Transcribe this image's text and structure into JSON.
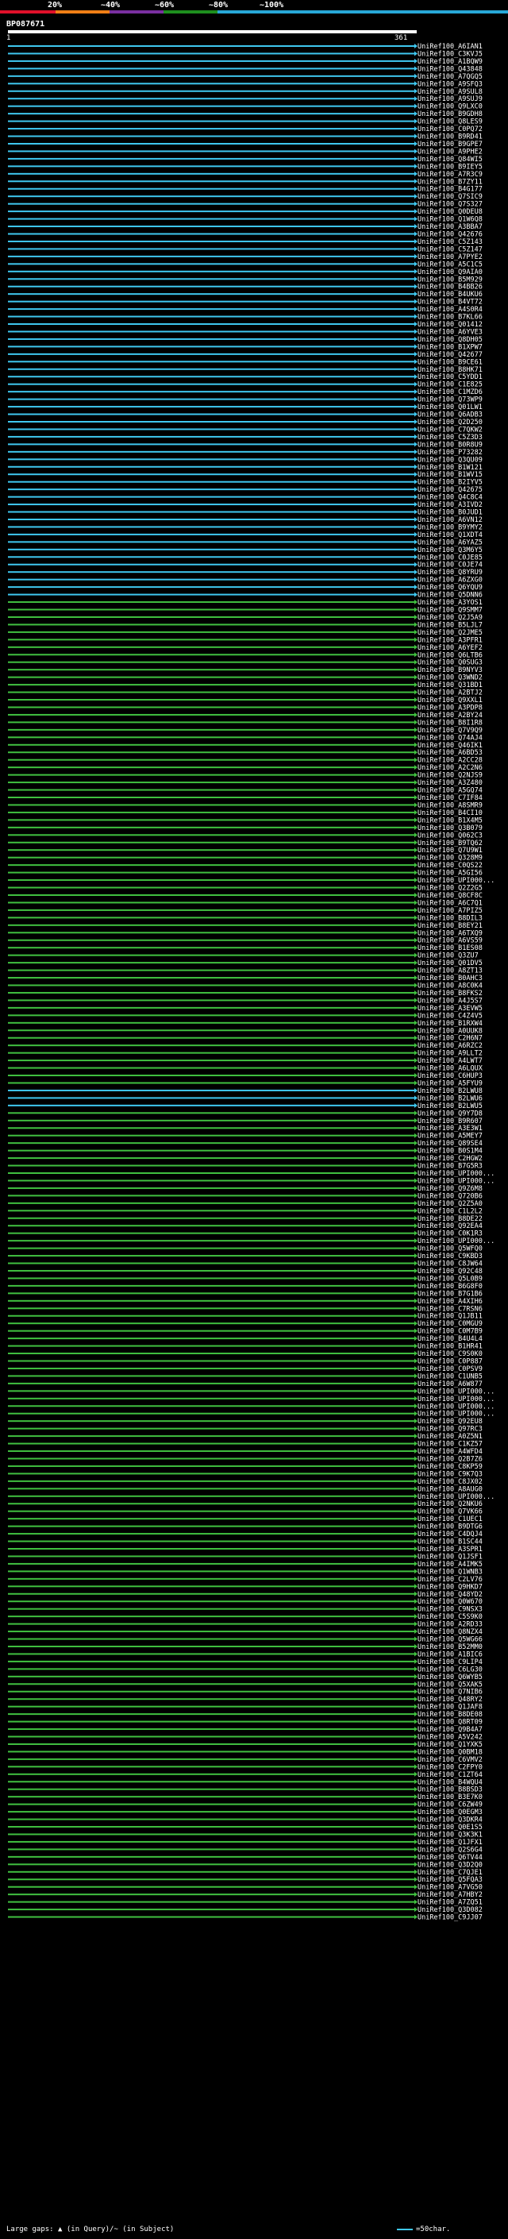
{
  "scale": {
    "ticks": [
      "20%",
      "~40%",
      "~60%",
      "~80%",
      "~100%"
    ],
    "colors": [
      "#e0102a",
      "#f07f16",
      "#7a2fa0",
      "#1e8f1e",
      "#28a8d8"
    ]
  },
  "query": {
    "id": "BP087671",
    "start": "1",
    "end": "361"
  },
  "colors": {
    "blue": "#3fc8f0",
    "green": "#40c040",
    "background": "#000000"
  },
  "hits": [
    {
      "id": "UniRef100_A6IAN1",
      "c": "b"
    },
    {
      "id": "UniRef100_C3KVJ5",
      "c": "b"
    },
    {
      "id": "UniRef100_A1BQW9",
      "c": "b"
    },
    {
      "id": "UniRef100_Q43848",
      "c": "b"
    },
    {
      "id": "UniRef100_A7QGQ5",
      "c": "b"
    },
    {
      "id": "UniRef100_A9SFQ3",
      "c": "b"
    },
    {
      "id": "UniRef100_A9SUL8",
      "c": "b"
    },
    {
      "id": "UniRef100_A9SUJ9",
      "c": "b"
    },
    {
      "id": "UniRef100_Q9LXC0",
      "c": "b"
    },
    {
      "id": "UniRef100_B9GDH8",
      "c": "b"
    },
    {
      "id": "UniRef100_Q8LES9",
      "c": "b"
    },
    {
      "id": "UniRef100_C0PQ72",
      "c": "b"
    },
    {
      "id": "UniRef100_B9RD41",
      "c": "b"
    },
    {
      "id": "UniRef100_B9GPE7",
      "c": "b"
    },
    {
      "id": "UniRef100_A9PHE2",
      "c": "b"
    },
    {
      "id": "UniRef100_Q84WI5",
      "c": "b"
    },
    {
      "id": "UniRef100_B9IEY5",
      "c": "b"
    },
    {
      "id": "UniRef100_A7R3C9",
      "c": "b"
    },
    {
      "id": "UniRef100_B7ZY11",
      "c": "b"
    },
    {
      "id": "UniRef100_B4G177",
      "c": "b"
    },
    {
      "id": "UniRef100_Q7SIC9",
      "c": "b"
    },
    {
      "id": "UniRef100_Q7S327",
      "c": "b"
    },
    {
      "id": "UniRef100_Q0DEU8",
      "c": "b"
    },
    {
      "id": "UniRef100_Q1W6Q8",
      "c": "b"
    },
    {
      "id": "UniRef100_A3BBA7",
      "c": "b"
    },
    {
      "id": "UniRef100_Q42676",
      "c": "b"
    },
    {
      "id": "UniRef100_C5Z143",
      "c": "b"
    },
    {
      "id": "UniRef100_C5Z147",
      "c": "b"
    },
    {
      "id": "UniRef100_A7PYE2",
      "c": "b"
    },
    {
      "id": "UniRef100_A5C1C5",
      "c": "b"
    },
    {
      "id": "UniRef100_Q9AIA0",
      "c": "b"
    },
    {
      "id": "UniRef100_B5M929",
      "c": "b"
    },
    {
      "id": "UniRef100_B4BB26",
      "c": "b"
    },
    {
      "id": "UniRef100_B4UKU6",
      "c": "b"
    },
    {
      "id": "UniRef100_B4VT72",
      "c": "b"
    },
    {
      "id": "UniRef100_A4S0R4",
      "c": "b"
    },
    {
      "id": "UniRef100_B7KL66",
      "c": "b"
    },
    {
      "id": "UniRef100_Q01412",
      "c": "b"
    },
    {
      "id": "UniRef100_A6YVE3",
      "c": "b"
    },
    {
      "id": "UniRef100_Q8DH05",
      "c": "b"
    },
    {
      "id": "UniRef100_B1XPW7",
      "c": "b"
    },
    {
      "id": "UniRef100_Q42677",
      "c": "b"
    },
    {
      "id": "UniRef100_B9CE61",
      "c": "b"
    },
    {
      "id": "UniRef100_B8HK71",
      "c": "b"
    },
    {
      "id": "UniRef100_C5YDD1",
      "c": "b"
    },
    {
      "id": "UniRef100_C1E825",
      "c": "b"
    },
    {
      "id": "UniRef100_C1MZD6",
      "c": "b"
    },
    {
      "id": "UniRef100_Q73WP9",
      "c": "b"
    },
    {
      "id": "UniRef100_Q01LW1",
      "c": "b"
    },
    {
      "id": "UniRef100_Q6ADB3",
      "c": "b"
    },
    {
      "id": "UniRef100_Q2D250",
      "c": "b"
    },
    {
      "id": "UniRef100_C7QKW2",
      "c": "b"
    },
    {
      "id": "UniRef100_C5Z3D3",
      "c": "b"
    },
    {
      "id": "UniRef100_B0R8U9",
      "c": "b"
    },
    {
      "id": "UniRef100_P73282",
      "c": "b"
    },
    {
      "id": "UniRef100_Q3QU09",
      "c": "b"
    },
    {
      "id": "UniRef100_B1W121",
      "c": "b"
    },
    {
      "id": "UniRef100_B1WV15",
      "c": "b"
    },
    {
      "id": "UniRef100_B2IYV5",
      "c": "b"
    },
    {
      "id": "UniRef100_Q42675",
      "c": "b"
    },
    {
      "id": "UniRef100_Q4C8C4",
      "c": "b"
    },
    {
      "id": "UniRef100_A3IVD2",
      "c": "b"
    },
    {
      "id": "UniRef100_B0JUD1",
      "c": "b"
    },
    {
      "id": "UniRef100_A6VN12",
      "c": "b"
    },
    {
      "id": "UniRef100_B9YMY2",
      "c": "b"
    },
    {
      "id": "UniRef100_Q1XDT4",
      "c": "b"
    },
    {
      "id": "UniRef100_A6YAZ5",
      "c": "b"
    },
    {
      "id": "UniRef100_Q3M6Y5",
      "c": "b"
    },
    {
      "id": "UniRef100_C0JE85",
      "c": "b"
    },
    {
      "id": "UniRef100_C0JE74",
      "c": "b"
    },
    {
      "id": "UniRef100_Q8YRU9",
      "c": "b"
    },
    {
      "id": "UniRef100_A6ZXG0",
      "c": "b"
    },
    {
      "id": "UniRef100_Q6YQU9",
      "c": "b"
    },
    {
      "id": "UniRef100_Q5DNN6",
      "c": "b"
    },
    {
      "id": "UniRef100_A3YOS1",
      "c": "g"
    },
    {
      "id": "UniRef100_Q9SMM7",
      "c": "g"
    },
    {
      "id": "UniRef100_Q2J5A9",
      "c": "g"
    },
    {
      "id": "UniRef100_B5LJL7",
      "c": "g"
    },
    {
      "id": "UniRef100_Q2JME5",
      "c": "g"
    },
    {
      "id": "UniRef100_A3PFR1",
      "c": "g"
    },
    {
      "id": "UniRef100_A6YEF2",
      "c": "g"
    },
    {
      "id": "UniRef100_Q6LTB6",
      "c": "g"
    },
    {
      "id": "UniRef100_Q0SUG3",
      "c": "g"
    },
    {
      "id": "UniRef100_B9NYV3",
      "c": "g"
    },
    {
      "id": "UniRef100_Q3WND2",
      "c": "g"
    },
    {
      "id": "UniRef100_Q31BD1",
      "c": "g"
    },
    {
      "id": "UniRef100_A2BTJ2",
      "c": "g"
    },
    {
      "id": "UniRef100_Q9XXL1",
      "c": "g"
    },
    {
      "id": "UniRef100_A3PDP8",
      "c": "g"
    },
    {
      "id": "UniRef100_A2BY24",
      "c": "g"
    },
    {
      "id": "UniRef100_B8I1R8",
      "c": "g"
    },
    {
      "id": "UniRef100_Q7V9Q9",
      "c": "g"
    },
    {
      "id": "UniRef100_Q74AJ4",
      "c": "g"
    },
    {
      "id": "UniRef100_Q46IK1",
      "c": "g"
    },
    {
      "id": "UniRef100_A6BD53",
      "c": "g"
    },
    {
      "id": "UniRef100_A2CC28",
      "c": "g"
    },
    {
      "id": "UniRef100_A2C2N6",
      "c": "g"
    },
    {
      "id": "UniRef100_Q2NJS9",
      "c": "g"
    },
    {
      "id": "UniRef100_A3Z480",
      "c": "g"
    },
    {
      "id": "UniRef100_A5GQ74",
      "c": "g"
    },
    {
      "id": "UniRef100_C7IF84",
      "c": "g"
    },
    {
      "id": "UniRef100_A8SMR9",
      "c": "g"
    },
    {
      "id": "UniRef100_B4CI10",
      "c": "g"
    },
    {
      "id": "UniRef100_B1X4M5",
      "c": "g"
    },
    {
      "id": "UniRef100_Q3B079",
      "c": "g"
    },
    {
      "id": "UniRef100_Q062C3",
      "c": "g"
    },
    {
      "id": "UniRef100_B9TQ62",
      "c": "g"
    },
    {
      "id": "UniRef100_Q7U9W1",
      "c": "g"
    },
    {
      "id": "UniRef100_Q328M9",
      "c": "g"
    },
    {
      "id": "UniRef100_C0QS22",
      "c": "g"
    },
    {
      "id": "UniRef100_A5GI56",
      "c": "g"
    },
    {
      "id": "UniRef100_UPI000...",
      "c": "g"
    },
    {
      "id": "UniRef100_Q2Z2G5",
      "c": "g"
    },
    {
      "id": "UniRef100_Q8CF8C",
      "c": "g"
    },
    {
      "id": "UniRef100_A6C7Q1",
      "c": "g"
    },
    {
      "id": "UniRef100_A7PIZ5",
      "c": "g"
    },
    {
      "id": "UniRef100_B8DIL3",
      "c": "g"
    },
    {
      "id": "UniRef100_B8EY21",
      "c": "g"
    },
    {
      "id": "UniRef100_A6TXQ9",
      "c": "g"
    },
    {
      "id": "UniRef100_A6VS59",
      "c": "g"
    },
    {
      "id": "UniRef100_B1ES08",
      "c": "g"
    },
    {
      "id": "UniRef100_Q3ZU7",
      "c": "g"
    },
    {
      "id": "UniRef100_Q01DV5",
      "c": "g"
    },
    {
      "id": "UniRef100_A8ZT13",
      "c": "g"
    },
    {
      "id": "UniRef100_B0AHC3",
      "c": "g"
    },
    {
      "id": "UniRef100_A8C0K4",
      "c": "g"
    },
    {
      "id": "UniRef100_B8FKS2",
      "c": "g"
    },
    {
      "id": "UniRef100_A4J5S7",
      "c": "g"
    },
    {
      "id": "UniRef100_A3EVW5",
      "c": "g"
    },
    {
      "id": "UniRef100_C4Z4V5",
      "c": "g"
    },
    {
      "id": "UniRef100_B1RXW4",
      "c": "g"
    },
    {
      "id": "UniRef100_A0UUK8",
      "c": "g"
    },
    {
      "id": "UniRef100_C2H6N7",
      "c": "g"
    },
    {
      "id": "UniRef100_A6RZC2",
      "c": "g"
    },
    {
      "id": "UniRef100_A9LLT2",
      "c": "g"
    },
    {
      "id": "UniRef100_A4LWT7",
      "c": "g"
    },
    {
      "id": "UniRef100_A6LQUX",
      "c": "g"
    },
    {
      "id": "UniRef100_C6HUP3",
      "c": "g"
    },
    {
      "id": "UniRef100_A5FYU9",
      "c": "g"
    },
    {
      "id": "UniRef100_B2LWU8",
      "c": "b"
    },
    {
      "id": "UniRef100_B2LWU6",
      "c": "b"
    },
    {
      "id": "UniRef100_B2LWU5",
      "c": "b"
    },
    {
      "id": "UniRef100_Q9Y7D8",
      "c": "g"
    },
    {
      "id": "UniRef100_B9R607",
      "c": "g"
    },
    {
      "id": "UniRef100_A3E3W1",
      "c": "g"
    },
    {
      "id": "UniRef100_A5MEY7",
      "c": "g"
    },
    {
      "id": "UniRef100_Q89SE4",
      "c": "g"
    },
    {
      "id": "UniRef100_B0S1M4",
      "c": "g"
    },
    {
      "id": "UniRef100_C2HGW2",
      "c": "g"
    },
    {
      "id": "UniRef100_B7G5R3",
      "c": "g"
    },
    {
      "id": "UniRef100_UPI000...",
      "c": "g"
    },
    {
      "id": "UniRef100_UPI000...",
      "c": "g"
    },
    {
      "id": "UniRef100_Q9Z6M8",
      "c": "g"
    },
    {
      "id": "UniRef100_Q720B6",
      "c": "g"
    },
    {
      "id": "UniRef100_Q2Z5A0",
      "c": "g"
    },
    {
      "id": "UniRef100_C1L2L2",
      "c": "g"
    },
    {
      "id": "UniRef100_B8DE22",
      "c": "g"
    },
    {
      "id": "UniRef100_Q92EA4",
      "c": "g"
    },
    {
      "id": "UniRef100_C0K1R3",
      "c": "g"
    },
    {
      "id": "UniRef100_UPI000...",
      "c": "g"
    },
    {
      "id": "UniRef100_Q5WFQ0",
      "c": "g"
    },
    {
      "id": "UniRef100_C9KBD3",
      "c": "g"
    },
    {
      "id": "UniRef100_C8JW64",
      "c": "g"
    },
    {
      "id": "UniRef100_Q92C48",
      "c": "g"
    },
    {
      "id": "UniRef100_Q5L0B9",
      "c": "g"
    },
    {
      "id": "UniRef100_B6G8F0",
      "c": "g"
    },
    {
      "id": "UniRef100_B7G1B6",
      "c": "g"
    },
    {
      "id": "UniRef100_A4XIH6",
      "c": "g"
    },
    {
      "id": "UniRef100_C7RSN6",
      "c": "g"
    },
    {
      "id": "UniRef100_Q1JB11",
      "c": "g"
    },
    {
      "id": "UniRef100_C0MGU9",
      "c": "g"
    },
    {
      "id": "UniRef100_C0M7B9",
      "c": "g"
    },
    {
      "id": "UniRef100_B4U4L4",
      "c": "g"
    },
    {
      "id": "UniRef100_B1HR41",
      "c": "g"
    },
    {
      "id": "UniRef100_C9S0K0",
      "c": "g"
    },
    {
      "id": "UniRef100_C0P887",
      "c": "g"
    },
    {
      "id": "UniRef100_C0PSV9",
      "c": "g"
    },
    {
      "id": "UniRef100_C1UNB5",
      "c": "g"
    },
    {
      "id": "UniRef100_A6W877",
      "c": "g"
    },
    {
      "id": "UniRef100_UPI000...",
      "c": "g"
    },
    {
      "id": "UniRef100_UPI000...",
      "c": "g"
    },
    {
      "id": "UniRef100_UPI000...",
      "c": "g"
    },
    {
      "id": "UniRef100_UPI000...",
      "c": "g"
    },
    {
      "id": "UniRef100_Q92EU8",
      "c": "g"
    },
    {
      "id": "UniRef100_Q97RC3",
      "c": "g"
    },
    {
      "id": "UniRef100_A0Z5N1",
      "c": "g"
    },
    {
      "id": "UniRef100_C1KZ57",
      "c": "g"
    },
    {
      "id": "UniRef100_A4WFD4",
      "c": "g"
    },
    {
      "id": "UniRef100_Q2B7Z6",
      "c": "g"
    },
    {
      "id": "UniRef100_C8KP59",
      "c": "g"
    },
    {
      "id": "UniRef100_C9K7Q3",
      "c": "g"
    },
    {
      "id": "UniRef100_C8JX02",
      "c": "g"
    },
    {
      "id": "UniRef100_A8AUG0",
      "c": "g"
    },
    {
      "id": "UniRef100_UPI000...",
      "c": "g"
    },
    {
      "id": "UniRef100_Q2NKU6",
      "c": "g"
    },
    {
      "id": "UniRef100_Q7VK66",
      "c": "g"
    },
    {
      "id": "UniRef100_C1UEC1",
      "c": "g"
    },
    {
      "id": "UniRef100_B9DTG6",
      "c": "g"
    },
    {
      "id": "UniRef100_C4DQJ4",
      "c": "g"
    },
    {
      "id": "UniRef100_B1SC44",
      "c": "g"
    },
    {
      "id": "UniRef100_A3SPR1",
      "c": "g"
    },
    {
      "id": "UniRef100_Q1JSF1",
      "c": "g"
    },
    {
      "id": "UniRef100_A4IMK5",
      "c": "g"
    },
    {
      "id": "UniRef100_Q1WNB3",
      "c": "g"
    },
    {
      "id": "UniRef100_C2LV76",
      "c": "g"
    },
    {
      "id": "UniRef100_Q9HKD7",
      "c": "g"
    },
    {
      "id": "UniRef100_Q48YD2",
      "c": "g"
    },
    {
      "id": "UniRef100_Q0W670",
      "c": "g"
    },
    {
      "id": "UniRef100_C9NSX3",
      "c": "g"
    },
    {
      "id": "UniRef100_C5S9K0",
      "c": "g"
    },
    {
      "id": "UniRef100_A2RD33",
      "c": "g"
    },
    {
      "id": "UniRef100_Q8NZX4",
      "c": "g"
    },
    {
      "id": "UniRef100_Q5WG66",
      "c": "g"
    },
    {
      "id": "UniRef100_B52MM0",
      "c": "g"
    },
    {
      "id": "UniRef100_A1BIC6",
      "c": "g"
    },
    {
      "id": "UniRef100_C9LIP4",
      "c": "g"
    },
    {
      "id": "UniRef100_C6LG30",
      "c": "g"
    },
    {
      "id": "UniRef100_Q6WYB5",
      "c": "g"
    },
    {
      "id": "UniRef100_Q5XAK5",
      "c": "g"
    },
    {
      "id": "UniRef100_Q7NIB6",
      "c": "g"
    },
    {
      "id": "UniRef100_Q48RY2",
      "c": "g"
    },
    {
      "id": "UniRef100_Q1JAF8",
      "c": "g"
    },
    {
      "id": "UniRef100_B8DE08",
      "c": "g"
    },
    {
      "id": "UniRef100_Q8RT09",
      "c": "g"
    },
    {
      "id": "UniRef100_Q9B4A7",
      "c": "g"
    },
    {
      "id": "UniRef100_A5V242",
      "c": "g"
    },
    {
      "id": "UniRef100_Q1YXK5",
      "c": "g"
    },
    {
      "id": "UniRef100_Q0BM18",
      "c": "g"
    },
    {
      "id": "UniRef100_C6VMV2",
      "c": "g"
    },
    {
      "id": "UniRef100_C2FPY0",
      "c": "g"
    },
    {
      "id": "UniRef100_C1ZT64",
      "c": "g"
    },
    {
      "id": "UniRef100_B4WQU4",
      "c": "g"
    },
    {
      "id": "UniRef100_B8BSD3",
      "c": "g"
    },
    {
      "id": "UniRef100_B3E7K0",
      "c": "g"
    },
    {
      "id": "UniRef100_C6ZW49",
      "c": "g"
    },
    {
      "id": "UniRef100_Q0EGM3",
      "c": "g"
    },
    {
      "id": "UniRef100_Q3DKR4",
      "c": "g"
    },
    {
      "id": "UniRef100_Q0E1S5",
      "c": "g"
    },
    {
      "id": "UniRef100_Q3K3K1",
      "c": "g"
    },
    {
      "id": "UniRef100_Q1JFX1",
      "c": "g"
    },
    {
      "id": "UniRef100_Q2S6G4",
      "c": "g"
    },
    {
      "id": "UniRef100_Q6TV44",
      "c": "g"
    },
    {
      "id": "UniRef100_Q3D2Q0",
      "c": "g"
    },
    {
      "id": "UniRef100_C7QJE1",
      "c": "g"
    },
    {
      "id": "UniRef100_Q5FQA3",
      "c": "g"
    },
    {
      "id": "UniRef100_A7VG50",
      "c": "g"
    },
    {
      "id": "UniRef100_A7HBY2",
      "c": "g"
    },
    {
      "id": "UniRef100_A7ZQ51",
      "c": "g"
    },
    {
      "id": "UniRef100_Q3D082",
      "c": "g"
    },
    {
      "id": "UniRef100_C9JJ07",
      "c": "g"
    }
  ],
  "legend": {
    "large_gaps": "Large gaps: ▲ (in Query)/~ (in Subject)",
    "scale_note": "=50char."
  }
}
